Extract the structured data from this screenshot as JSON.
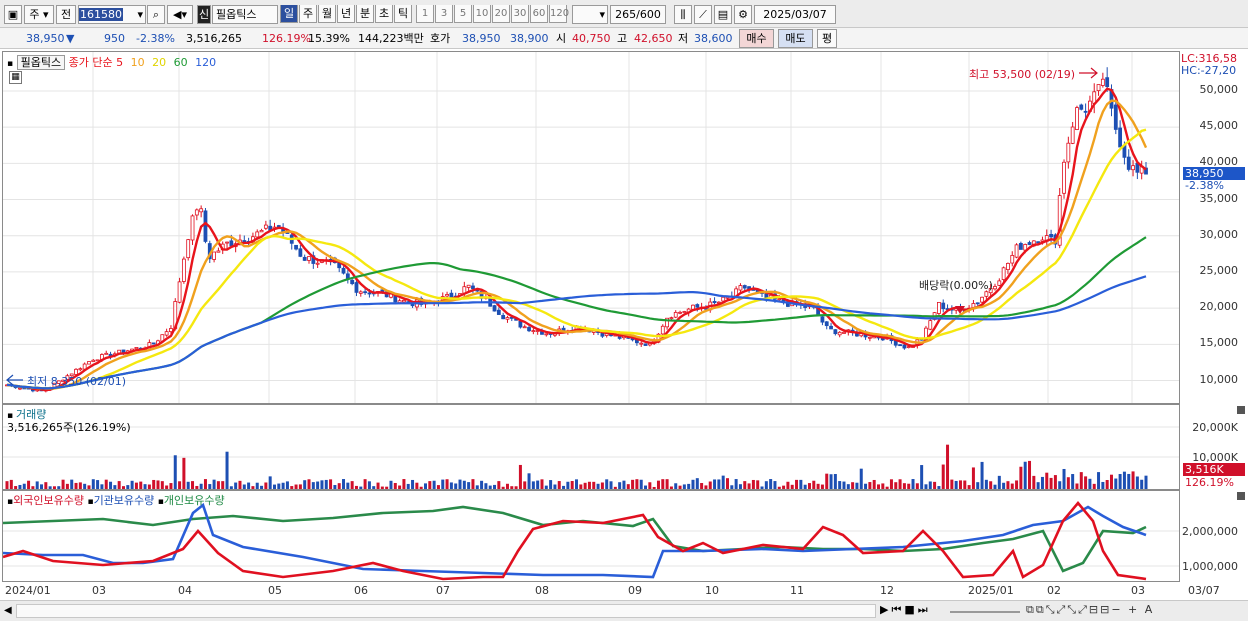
{
  "toolbar": {
    "market": "주",
    "prev": "전",
    "code": "161580",
    "name_badge": "신",
    "stock_name": "필옵틱스",
    "periods": [
      "일",
      "주",
      "월",
      "년",
      "분",
      "초",
      "틱"
    ],
    "period_nums": [
      "1",
      "3",
      "5",
      "10",
      "20",
      "30",
      "60",
      "120"
    ],
    "count": "265",
    "count_total": "/600",
    "date": "2025/03/07"
  },
  "info": {
    "price": "38,950",
    "arrow": "▼",
    "change": "950",
    "change_pct": "-2.38%",
    "volume": "3,516,265",
    "vol_ratio": "126.19%",
    "turnover": "15.39%",
    "amount": "144,223백만",
    "quote_label": "호가",
    "ask": "38,950",
    "bid": "38,900",
    "open_label": "시",
    "open": "40,750",
    "high_label": "고",
    "high": "42,650",
    "low_label": "저",
    "low": "38,600",
    "buy": "매수",
    "sell": "매도",
    "eval": "평"
  },
  "price_panel": {
    "legend_name": "필옵틱스",
    "legend_ma": "종가 단순",
    "ma_periods": [
      "5",
      "10",
      "20",
      "60",
      "120"
    ],
    "ma_colors": [
      "#e8141c",
      "#f0a11e",
      "#f5e80f",
      "#1f9a35",
      "#2a5ed8"
    ],
    "lc": "LC:316,58",
    "hc": "HC:-27,20",
    "high_note": "최고 53,500 (02/19)",
    "low_note": "최저 8,350 (02/01)",
    "dividend_note": "배당락(0.00%)",
    "yticks": [
      "50,000",
      "45,000",
      "40,000",
      "35,000",
      "30,000",
      "25,000",
      "20,000",
      "15,000",
      "10,000"
    ],
    "current": "38,950",
    "current_pct": "-2.38%"
  },
  "volume_panel": {
    "title": "거래량",
    "value": "3,516,265주(126.19%)",
    "yticks": [
      "20,000K",
      "10,000K"
    ],
    "current": "3,516K",
    "current_pct": "126.19%"
  },
  "holding_panel": {
    "titles": [
      "외국인보유수량",
      "기관보유수량",
      "개인보유수량"
    ],
    "yticks": [
      "2,000,000",
      "1,000,000"
    ]
  },
  "xaxis": [
    "2024/01",
    "03",
    "04",
    "05",
    "06",
    "07",
    "08",
    "09",
    "10",
    "11",
    "12",
    "2025/01",
    "02",
    "03"
  ],
  "xaxis_right": "03/07",
  "chart_data": {
    "type": "candlestick",
    "title": "필옵틱스",
    "x_range": [
      "2024/01",
      "2025/03/07"
    ],
    "ylim": [
      8000,
      54000
    ],
    "close_path": [
      [
        "2024/01",
        9500
      ],
      [
        "2024/02/01",
        8350
      ],
      [
        "2024/03",
        13500
      ],
      [
        "2024/04/10",
        35000
      ],
      [
        "2024/04/20",
        27000
      ],
      [
        "2024/05",
        30000
      ],
      [
        "2024/06",
        24000
      ],
      [
        "2024/06/20",
        21500
      ],
      [
        "2024/07",
        22500
      ],
      [
        "2024/08",
        17500
      ],
      [
        "2024/09",
        15000
      ],
      [
        "2024/10",
        21000
      ],
      [
        "2024/10/20",
        22000
      ],
      [
        "2024/11",
        18000
      ],
      [
        "2024/12",
        14500
      ],
      [
        "2024/12/20",
        20000
      ],
      [
        "2025/01/20",
        31000
      ],
      [
        "2025/02/10",
        48000
      ],
      [
        "2025/02/19",
        53500
      ],
      [
        "2025/03/07",
        38950
      ]
    ],
    "series": [
      {
        "name": "5",
        "color": "#e8141c"
      },
      {
        "name": "10",
        "color": "#f0a11e"
      },
      {
        "name": "20",
        "color": "#f5e80f"
      },
      {
        "name": "60",
        "color": "#1f9a35"
      },
      {
        "name": "120",
        "color": "#2a5ed8"
      }
    ]
  }
}
